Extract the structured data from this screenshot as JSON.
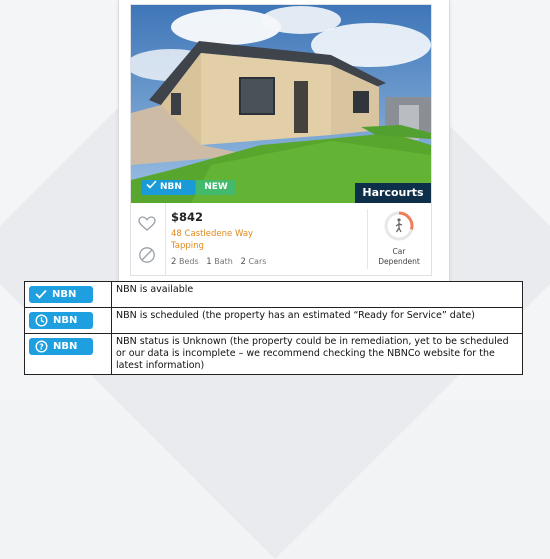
{
  "listing": {
    "badges": {
      "nbn": "NBN",
      "new": "NEW"
    },
    "brand": "Harcourts",
    "price": "$842",
    "address_line1": "48 Castledene Way",
    "address_line2": "Tapping",
    "features": {
      "beds_count": "2",
      "beds_label": "Beds",
      "bath_count": "1",
      "bath_label": "Bath",
      "cars_count": "2",
      "cars_label": "Cars"
    },
    "car_label_1": "Car",
    "car_label_2": "Dependent",
    "icons": [
      "heart-icon",
      "block-icon",
      "walk-score-gauge-icon",
      "pedestrian-icon"
    ]
  },
  "legend": {
    "rows": [
      {
        "pill": "NBN",
        "icon": "check-icon",
        "text": "NBN is available"
      },
      {
        "pill": "NBN",
        "icon": "clock-icon",
        "text": "NBN is scheduled (the property has an estimated “Ready for Service” date)"
      },
      {
        "pill": "NBN",
        "icon": "question-icon",
        "text": "NBN status is Unknown (the property could be in remediation, yet to be scheduled or our data is incomplete – we recommend checking the NBNCo website for the latest information)"
      }
    ]
  },
  "colors": {
    "nbn_blue": "#1d9fe0",
    "new_green": "#43b96b",
    "address_orange": "#e08a1c",
    "brand_navy": "#0d2f4a"
  }
}
